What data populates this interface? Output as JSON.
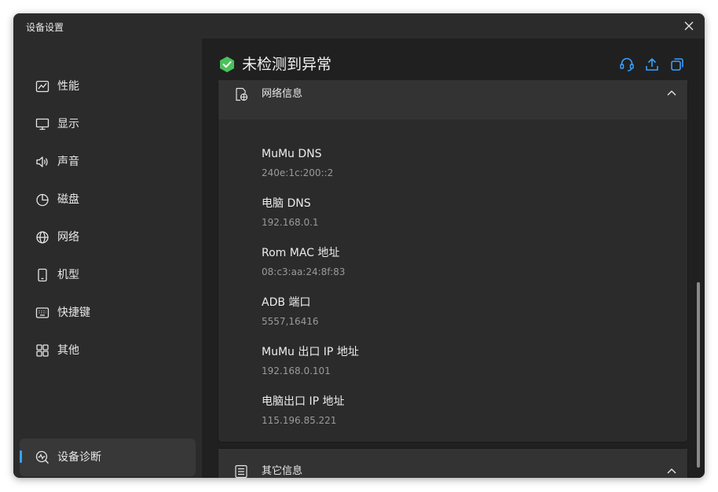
{
  "window": {
    "title": "设备设置"
  },
  "sidebar": {
    "items": [
      {
        "label": "性能",
        "icon": "chart-icon"
      },
      {
        "label": "显示",
        "icon": "monitor-icon"
      },
      {
        "label": "声音",
        "icon": "speaker-icon"
      },
      {
        "label": "磁盘",
        "icon": "pie-icon"
      },
      {
        "label": "网络",
        "icon": "globe-icon"
      },
      {
        "label": "机型",
        "icon": "phone-icon"
      },
      {
        "label": "快捷键",
        "icon": "keyboard-icon"
      },
      {
        "label": "其他",
        "icon": "grid-icon"
      }
    ],
    "active_item": {
      "label": "设备诊断",
      "icon": "diagnosis-icon"
    }
  },
  "header": {
    "status": "未检测到异常",
    "status_color": "#4cc05a",
    "accent_color": "#3aa0ff",
    "buttons": [
      "headset-icon",
      "upload-icon",
      "copy-icon"
    ]
  },
  "network_section": {
    "title": "网络信息",
    "rows": [
      {
        "label": "MuMu DNS",
        "value": "240e:1c:200::2"
      },
      {
        "label": "电脑 DNS",
        "value": "192.168.0.1"
      },
      {
        "label": "Rom MAC 地址",
        "value": "08:c3:aa:24:8f:83"
      },
      {
        "label": "ADB 端口",
        "value": "5557,16416"
      },
      {
        "label": "MuMu 出口 IP 地址",
        "value": "192.168.0.101"
      },
      {
        "label": "电脑出口 IP 地址",
        "value": "115.196.85.221"
      }
    ]
  },
  "other_section": {
    "title": "其它信息"
  }
}
